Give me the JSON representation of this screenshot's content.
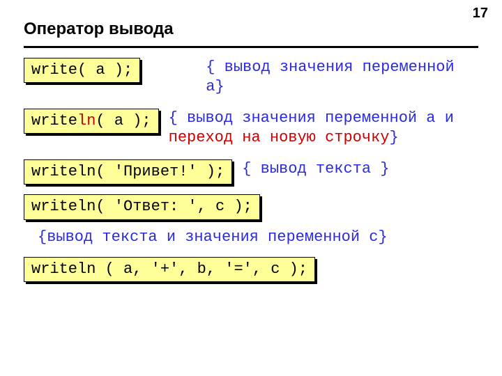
{
  "page_number": "17",
  "title": "Оператор вывода",
  "rows": [
    {
      "code_pre": "write( a );",
      "code_ln": "",
      "code_post": "",
      "comment_open": "{ ",
      "comment_body": "вывод значения переменной a",
      "comment_hi": "",
      "comment_close": "}"
    },
    {
      "code_pre": "write",
      "code_ln": "ln",
      "code_post": "( a );",
      "comment_open": "{ ",
      "comment_body": "вывод значения переменной a и ",
      "comment_hi": "переход на новую строчку",
      "comment_close": "}"
    },
    {
      "code_pre": "writeln( 'Привет!' );",
      "code_ln": "",
      "code_post": "",
      "comment_open": "{ ",
      "comment_body": "вывод текста ",
      "comment_hi": "",
      "comment_close": "}"
    },
    {
      "code_pre": "writeln( 'Ответ: ', c );",
      "code_ln": "",
      "code_post": ""
    }
  ],
  "standalone_comment": "{вывод текста и значения переменной c}",
  "last_code": "writeln ( a, '+', b, '=', c );"
}
